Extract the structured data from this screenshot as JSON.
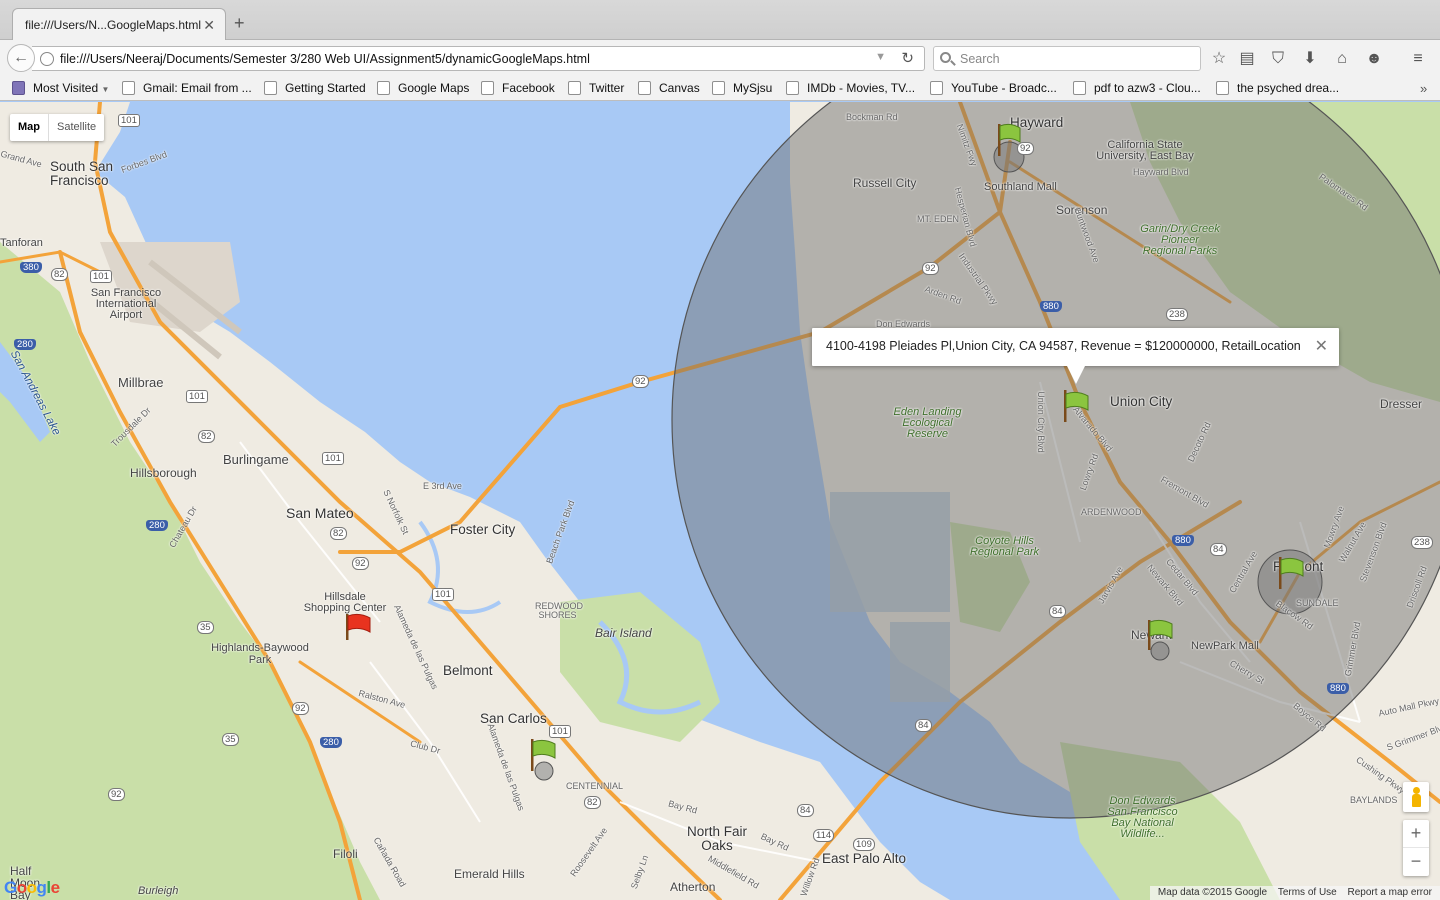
{
  "tab": {
    "title": "file:///Users/N...GoogleMaps.html",
    "close": "✕",
    "new": "+"
  },
  "nav": {
    "url": "file:///Users/Neeraj/Documents/Semester 3/280 Web UI/Assignment5/dynamicGoogleMaps.html",
    "search_placeholder": "Search"
  },
  "bookmarks": [
    "Most Visited",
    "Gmail: Email from ...",
    "Getting Started",
    "Google Maps",
    "Facebook",
    "Twitter",
    "Canvas",
    "MySjsu",
    "IMDb - Movies, TV...",
    "YouTube - Broadc...",
    "pdf to azw3 - Clou...",
    "the psyched drea..."
  ],
  "map": {
    "type_buttons": {
      "map": "Map",
      "satellite": "Satellite"
    },
    "infowindow": "4100-4198 Pleiades Pl,Union City, CA 94587, Revenue = $120000000, RetailLocation",
    "attribution": {
      "data": "Map data ©2015 Google",
      "terms": "Terms of Use",
      "report": "Report a map error"
    },
    "zoom": {
      "in": "+",
      "out": "−"
    },
    "labels": {
      "hayward": "Hayward",
      "csueb": "California State University, East Bay",
      "hayward_blvd": "Hayward Blvd",
      "bockman": "Bockman Rd",
      "russell": "Russell City",
      "southland": "Southland Mall",
      "sorenson": "Sorenson",
      "mt_eden": "MT. EDEN",
      "garin": "Garin/Dry Creek Pioneer Regional Parks",
      "palomares": "Palomares Rd",
      "arden": "Arden Rd",
      "industrial": "Industrial Pkwy",
      "don_edwards": "Don Edwards",
      "union_city": "Union City",
      "dresser": "Dresser",
      "eden_landing": "Eden Landing Ecological Reserve",
      "ardenwood": "ARDENWOOD",
      "coyote_hills": "Coyote Hills Regional Park",
      "fremont": "Fremont",
      "sundale": "SUNDALE",
      "newark": "Newark",
      "newpark": "NewPark Mall",
      "baylands": "BAYLANDS",
      "don_refuge": "Don Edwards San Francisco Bay National Wildlife...",
      "auto_mall": "Auto Mall Pkwy",
      "south_sf": "South San Francisco",
      "tanforan": "Tanforan",
      "grand_ave": "Grand Ave",
      "forbes": "Forbes Blvd",
      "sfo": "San Francisco International Airport",
      "san_andreas": "San Andreas Lake",
      "millbrae": "Millbrae",
      "trousdale": "Trousdale Dr",
      "burlingame": "Burlingame",
      "hillsborough": "Hillsborough",
      "san_mateo": "San Mateo",
      "chateau": "Chateau Dr",
      "e3rd": "E 3rd Ave",
      "norfolk": "S Norfolk St",
      "foster_city": "Foster City",
      "beach_park": "Beach Park Blvd",
      "hillsdale": "Hillsdale Shopping Center",
      "redwood_shores": "REDWOOD SHORES",
      "bair_island": "Bair Island",
      "highlands": "Highlands-Baywood Park",
      "alameda": "Alameda de las Pulgas",
      "ralston": "Ralston Ave",
      "belmont": "Belmont",
      "san_carlos": "San Carlos",
      "club_dr": "Club Dr",
      "centennial": "CENTENNIAL",
      "bay_rd": "Bay Rd",
      "north_fair_oaks": "North Fair Oaks",
      "east_palo_alto": "East Palo Alto",
      "middlefield": "Middlefield Rd",
      "filoli": "Filoli",
      "canada": "Cañada Road",
      "emerald_hills": "Emerald Hills",
      "atherton": "Atherton",
      "roosevelt": "Roosevelt Ave",
      "half_moon": "Half Moon Bay",
      "burleigh": "Burleigh",
      "selby": "Selby Ln",
      "willow": "Willow Rd",
      "cushing": "Cushing Pkwy",
      "grimmer": "S Grimmer Blvd",
      "boyce": "Boyce Rd",
      "cherry": "Cherry St",
      "mowry": "Mowry Ave",
      "stevenson": "Stevenson Blvd",
      "walnut": "Walnut Ave",
      "driscoll": "Driscoll Rd",
      "central": "Central Ave",
      "cedar": "Cedar Blvd",
      "newark_blvd": "Newark Blvd",
      "jarvis": "Jarvis Ave",
      "fremont_blvd": "Fremont Blvd",
      "decoto": "Decoto Rd",
      "lowry": "Lowry Rd",
      "alvarado": "Alvarado Blvd",
      "union_city_blvd": "Union City Blvd",
      "hesperian": "Hesperian Blvd",
      "nimitz": "Nimitz Fwy",
      "huntwood": "Huntwood Ave",
      "blacow": "Blacow Rd",
      "grimmer_blvd": "Grimmer Blvd"
    },
    "shields": {
      "i280a": "280",
      "i380": "380",
      "i280b": "280",
      "i280c": "280",
      "i280d": "280",
      "us101a": "101",
      "us101b": "101",
      "us101c": "101",
      "us101d": "101",
      "us101e": "101",
      "us101f": "101",
      "sr82a": "82",
      "sr82b": "82",
      "sr82c": "82",
      "sr82d": "82",
      "sr92a": "92",
      "sr92b": "92",
      "sr92c": "92",
      "sr92d": "92",
      "sr92e": "92",
      "sr92f": "92",
      "sr84a": "84",
      "sr84b": "84",
      "sr84c": "84",
      "sr84d": "84",
      "sr35a": "35",
      "sr35b": "35",
      "sr109": "109",
      "sr114": "114",
      "i880a": "880",
      "i880b": "880",
      "i880c": "880",
      "sr238a": "238",
      "sr238b": "238"
    }
  },
  "colors": {
    "water": "#a8c9f5",
    "land": "#efebe2",
    "park": "#c9dfa8",
    "highway": "#f3a33a",
    "circle_fill": "#6b6b6b",
    "flag_green": "#8bc53f",
    "flag_red": "#e8331f"
  }
}
